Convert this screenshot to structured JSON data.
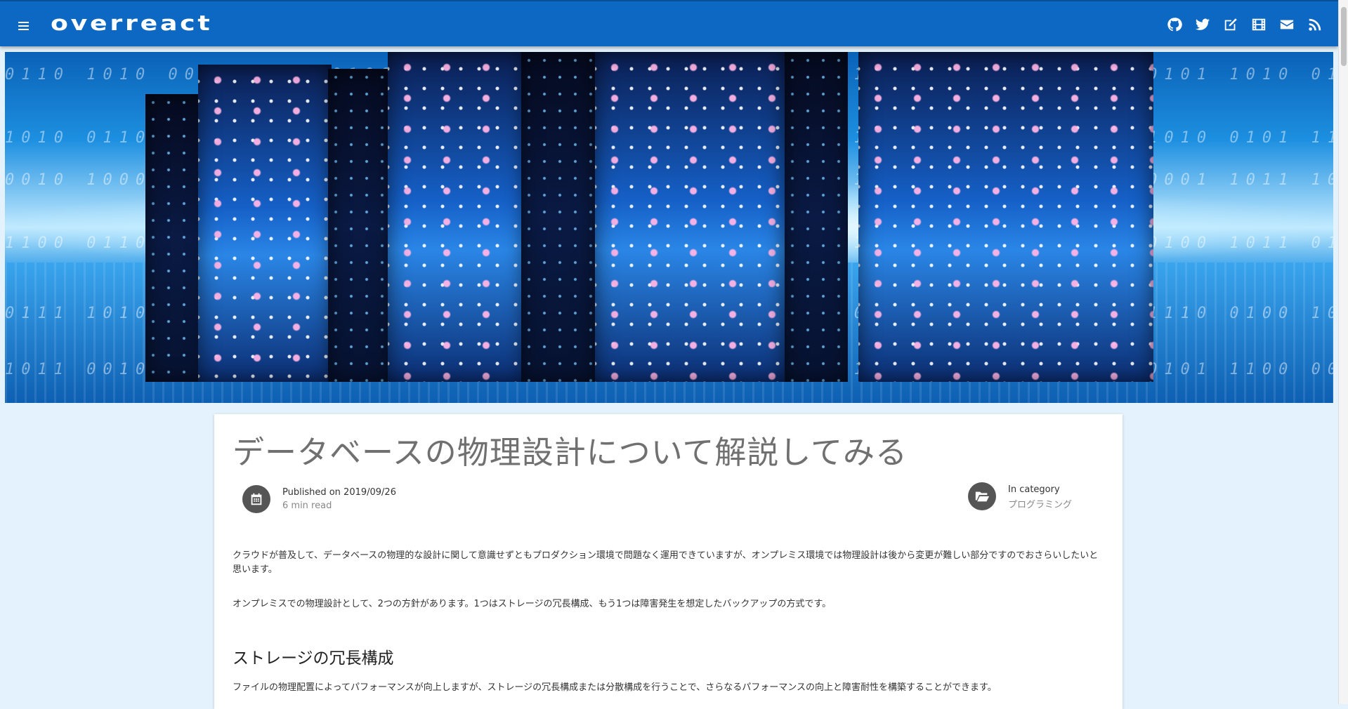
{
  "header": {
    "brand": "overreact",
    "icons": [
      "github-icon",
      "twitter-icon",
      "edit-icon",
      "film-icon",
      "envelope-icon",
      "rss-icon"
    ]
  },
  "article": {
    "title": "データベースの物理設計について解説してみる",
    "published": "Published on 2019/09/26",
    "read_time": "6 min read",
    "category_label": "In category",
    "category": "プログラミング",
    "paragraphs": [
      "クラウドが普及して、データベースの物理的な設計に関して意識せずともプロダクション環境で問題なく運用できていますが、オンプレミス環境では物理設計は後から変更が難しい部分ですのでおさらいしたいと思います。",
      "オンプレミスでの物理設計として、2つの方針があります。1つはストレージの冗長構成、もう1つは障害発生を想定したバックアップの方式です。"
    ],
    "section_heading": "ストレージの冗長構成",
    "section_paragraph": "ファイルの物理配置によってパフォーマンスが向上しますが、ストレージの冗長構成または分散構成を行うことで、さらなるパフォーマンスの向上と障害耐性を構築することができます。"
  },
  "colors": {
    "appbar": "#0d68c4",
    "page_background": "#e3f2fd",
    "title_text": "#707070"
  }
}
